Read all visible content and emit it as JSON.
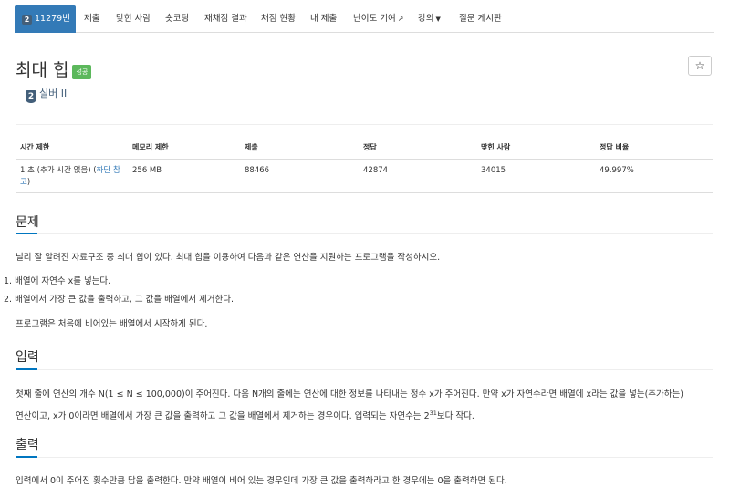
{
  "nav": {
    "active": {
      "tier_num": "2",
      "label": "11279번"
    },
    "items": [
      {
        "label": "제출"
      },
      {
        "label": "맞힌 사람"
      },
      {
        "label": "숏코딩"
      },
      {
        "label": "재채점 결과"
      },
      {
        "label": "채점 현황"
      },
      {
        "label": "내 제출"
      },
      {
        "label": "난이도 기여"
      },
      {
        "label": "강의"
      },
      {
        "label": "질문 게시판"
      }
    ]
  },
  "problem": {
    "title": "최대 힙",
    "status_badge": "성공",
    "star": "☆",
    "tier_num": "2",
    "tier": "실버 II"
  },
  "info": {
    "headers": [
      "시간 제한",
      "메모리 제한",
      "제출",
      "정답",
      "맞힌 사람",
      "정답 비율"
    ],
    "time_limit_main": "1 초 (추가 시간 없음) (",
    "time_limit_link": "하단 참고",
    "time_limit_close": ")",
    "memory": "256 MB",
    "submissions": "88466",
    "accepted": "42874",
    "solvers": "34015",
    "ratio": "49.997%"
  },
  "sections": {
    "problem": {
      "heading": "문제",
      "intro": "널리 잘 알려진 자료구조 중 최대 힙이 있다. 최대 힙을 이용하여 다음과 같은 연산을 지원하는 프로그램을 작성하시오.",
      "list": [
        "배열에 자연수 x를 넣는다.",
        "배열에서 가장 큰 값을 출력하고, 그 값을 배열에서 제거한다."
      ],
      "outro": "프로그램은 처음에 비어있는 배열에서 시작하게 된다."
    },
    "input": {
      "heading": "입력",
      "line1": "첫째 줄에 연산의 개수 N(1 ≤ N ≤ 100,000)이 주어진다. 다음 N개의 줄에는 연산에 대한 정보를 나타내는 정수 x가 주어진다. 만약 x가 자연수라면 배열에 x라는 값을 넣는(추가하는)",
      "line2_pre": "연산이고, x가 0이라면 배열에서 가장 큰 값을 출력하고 그 값을 배열에서 제거하는 경우이다. 입력되는 자연수는 2",
      "line2_sup": "31",
      "line2_post": "보다 작다."
    },
    "output": {
      "heading": "출력",
      "text": "입력에서 0이 주어진 횟수만큼 답을 출력한다. 만약 배열이 비어 있는 경우인데 가장 큰 값을 출력하라고 한 경우에는 0을 출력하면 된다."
    }
  }
}
